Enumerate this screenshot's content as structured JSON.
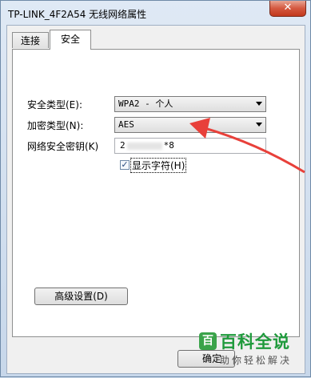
{
  "window": {
    "title": "TP-LINK_4F2A54 无线网络属性",
    "close_glyph": "✕"
  },
  "tabs": [
    {
      "label": "连接",
      "selected": false
    },
    {
      "label": "安全",
      "selected": true
    }
  ],
  "security_type": {
    "label": "安全类型(E):",
    "value": "WPA2 - 个人"
  },
  "encryption_type": {
    "label": "加密类型(N):",
    "value": "AES"
  },
  "network_key": {
    "label": "网络安全密钥(K)",
    "value_start": "2",
    "value_end": "*8"
  },
  "show_characters": {
    "label": "显示字符(H)",
    "checked": true,
    "check_glyph": "✓"
  },
  "advanced_button": {
    "label": "高级设置(D)"
  },
  "ok_button": {
    "label": "确定"
  },
  "annotation": {
    "color": "#e8403a"
  },
  "watermark": {
    "logo": "百",
    "title": "百科全说",
    "subtitle": "助你轻松解决"
  }
}
